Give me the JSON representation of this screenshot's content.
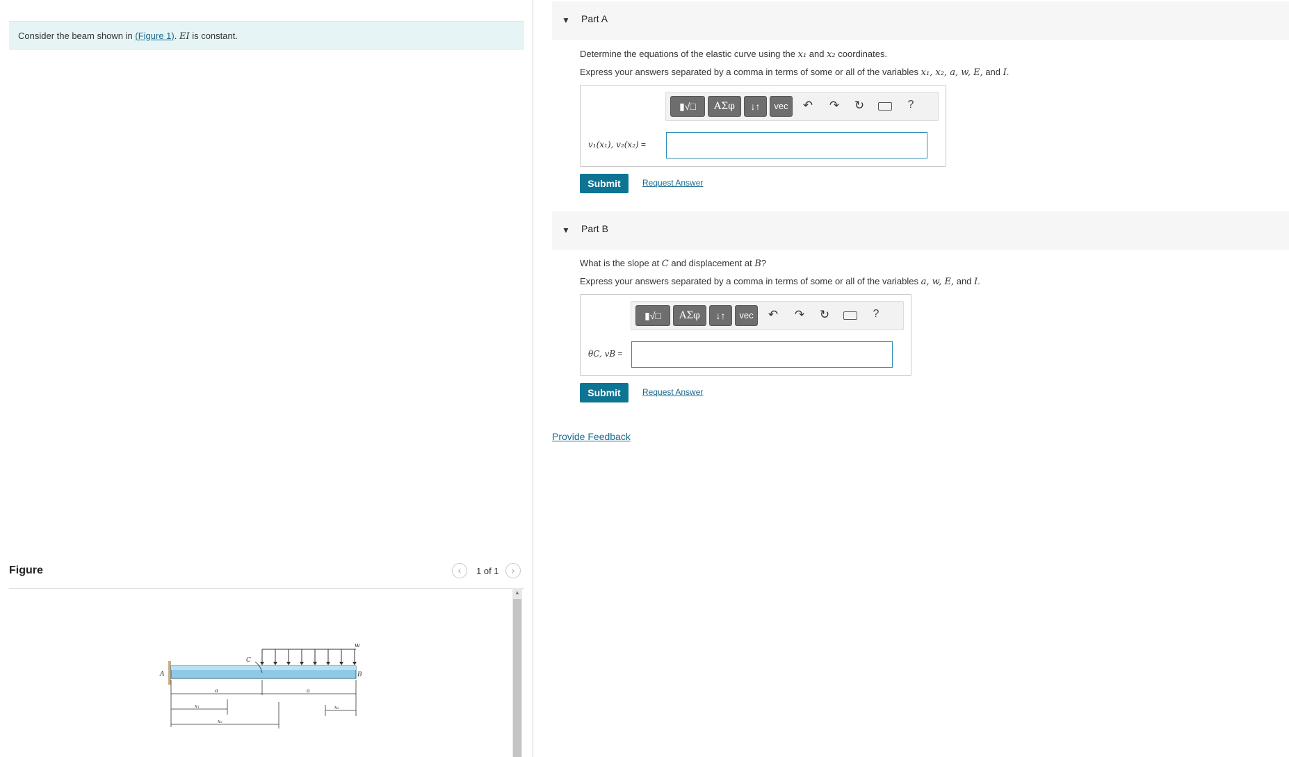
{
  "intro": {
    "prefix": "Consider the beam shown in ",
    "figure_link": "(Figure 1)",
    "ei": "EI",
    "suffix": " is constant."
  },
  "figure_panel": {
    "title": "Figure",
    "page_count": "1 of 1",
    "prev_icon": "chevron-left-icon",
    "next_icon": "chevron-right-icon",
    "labels": {
      "A": "A",
      "B": "B",
      "C": "C",
      "w": "w",
      "a_left": "a",
      "a_right": "a",
      "x1": "x₁",
      "x2": "x₂",
      "x3": "x₃"
    }
  },
  "toolbar": {
    "templates_icon": "▮√□",
    "greek": "ΑΣφ",
    "updown": "↓↑",
    "vec": "vec",
    "undo_icon": "↶",
    "redo_icon": "↷",
    "reset_icon": "↻",
    "help": "?"
  },
  "part_a": {
    "title": "Part A",
    "question_pre": "Determine the equations of the elastic curve using the ",
    "x1": "x₁",
    "and": " and ",
    "x2": "x₂",
    "question_post": " coordinates.",
    "instruction_pre": "Express your answers separated by a comma in terms of some or all of the variables ",
    "variables": "x₁, x₂, a, w, E,",
    "and_word": " and ",
    "last_var": "I",
    "period": ".",
    "answer_label_math": "v₁(x₁), v₂(x₂)",
    "answer_label_eq": " =",
    "answer_value": "",
    "submit": "Submit",
    "request_answer": "Request Answer"
  },
  "part_b": {
    "title": "Part B",
    "question_pre": "What is the slope at ",
    "c": "C",
    "mid": " and displacement at ",
    "b": "B",
    "question_post": "?",
    "instruction_pre": "Express your answers separated by a comma in terms of some or all of the variables ",
    "variables": "a, w, E,",
    "and_word": " and ",
    "last_var": "I",
    "period": ".",
    "answer_label_math": "θC, vB",
    "answer_label_eq": " =",
    "answer_value": "",
    "submit": "Submit",
    "request_answer": "Request Answer"
  },
  "feedback": "Provide Feedback"
}
